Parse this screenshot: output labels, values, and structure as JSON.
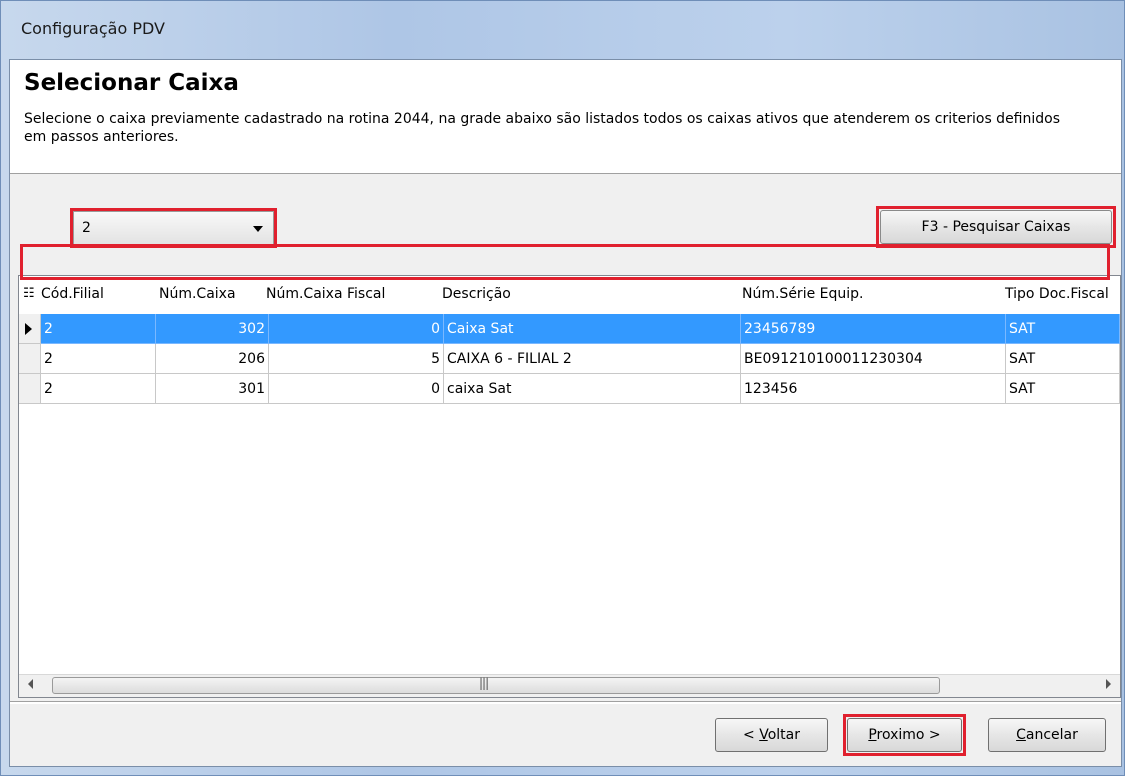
{
  "window": {
    "title": "Configuração PDV"
  },
  "header": {
    "title": "Selecionar Caixa",
    "description": "Selecione o caixa previamente cadastrado na rotina 2044, na grade abaixo são listados todos os caixas ativos que atenderem os criterios definidos em passos anteriores."
  },
  "filial_combo": {
    "value": "2"
  },
  "search_button": {
    "label": "F3 - Pesquisar Caixas"
  },
  "grid": {
    "columns": [
      "Cód.Filial",
      "Núm.Caixa",
      "Núm.Caixa Fiscal",
      "Descrição",
      "Núm.Série Equip.",
      "Tipo Doc.Fiscal"
    ],
    "rows": [
      {
        "filial": "2",
        "caixa": "302",
        "caixa_fiscal": "0",
        "descricao": "Caixa Sat",
        "serie": "23456789",
        "tipo": "SAT"
      },
      {
        "filial": "2",
        "caixa": "206",
        "caixa_fiscal": "5",
        "descricao": "CAIXA 6 - FILIAL 2",
        "serie": "BE091210100011230304",
        "tipo": "SAT"
      },
      {
        "filial": "2",
        "caixa": "301",
        "caixa_fiscal": "0",
        "descricao": "caixa Sat",
        "serie": "123456",
        "tipo": "SAT"
      }
    ],
    "selected_row": 0
  },
  "buttons": {
    "voltar_prefix": "< ",
    "voltar_mnemonic": "V",
    "voltar_rest": "oltar",
    "proximo_mnemonic": "P",
    "proximo_rest": "roximo >",
    "cancelar_mnemonic": "C",
    "cancelar_rest": "ancelar"
  },
  "colors": {
    "highlight": "#e0202e",
    "selection": "#3399ff"
  }
}
